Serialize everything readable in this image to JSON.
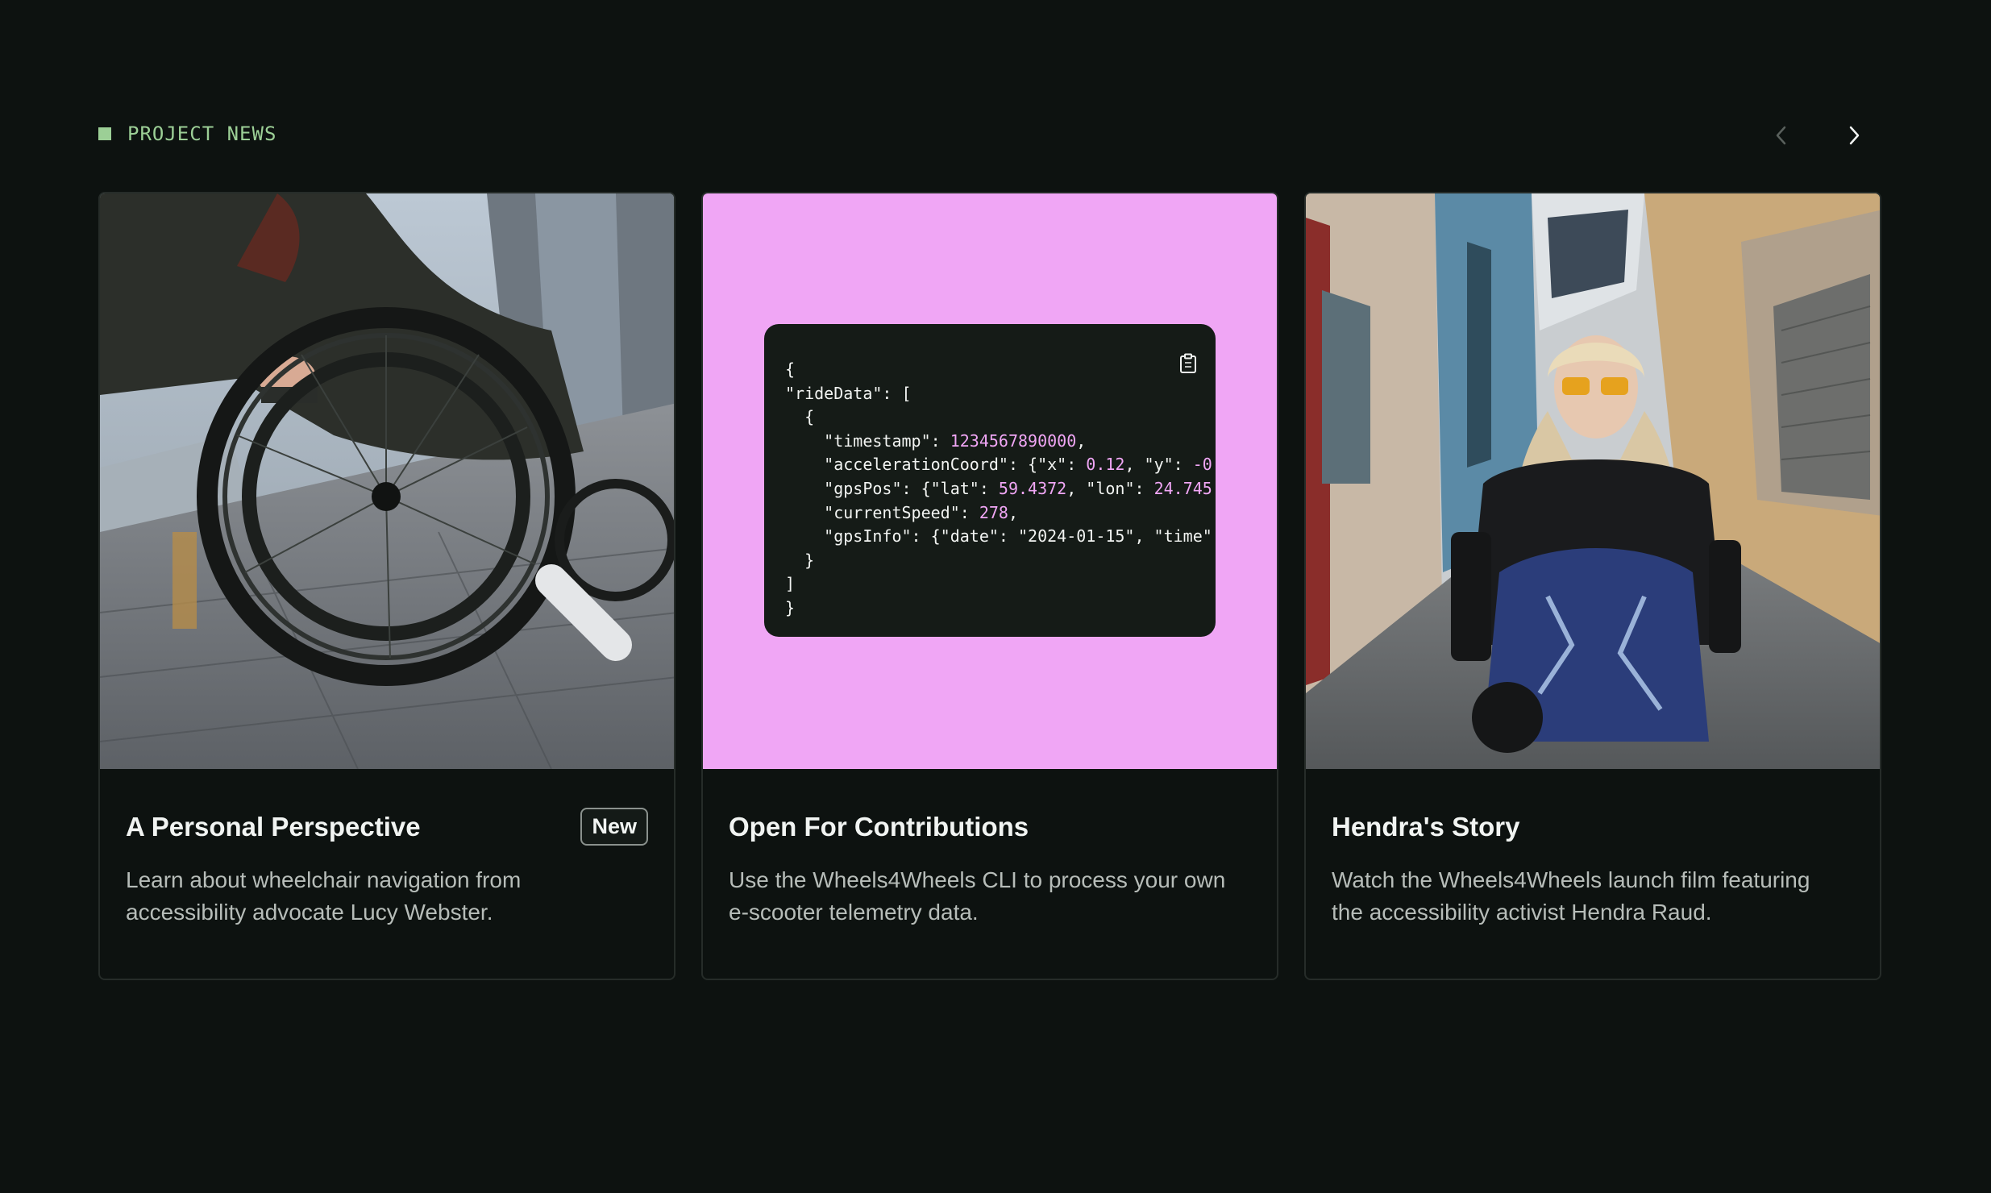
{
  "section": {
    "title": "PROJECT NEWS"
  },
  "nav": {
    "prev_icon": "chevron-left-icon",
    "next_icon": "chevron-right-icon"
  },
  "colors": {
    "background": "#0d1210",
    "accent": "#9ccf96",
    "pink": "#f0a6f5"
  },
  "cards": [
    {
      "title": "A Personal Perspective",
      "badge": "New",
      "description": "Learn about wheelchair navigation from accessibility advocate Lucy Webster."
    },
    {
      "title": "Open For Contributions",
      "description": "Use the Wheels4Wheels CLI to process your own e-scooter telemetry data.",
      "code": {
        "l1": "{",
        "l2": "\"rideData\": [",
        "l3": "  {",
        "l4_key": "    \"timestamp\": ",
        "l4_val": "1234567890000",
        "l4_end": ",",
        "l5_key": "    \"accelerationCoord\": {\"x\": ",
        "l5_val": "0.12",
        "l5_mid": ", \"y\": ",
        "l5_val2": "-0",
        "l6_key": "    \"gpsPos\": {\"lat\": ",
        "l6_val": "59.4372",
        "l6_mid": ", \"lon\": ",
        "l6_val2": "24.745",
        "l7_key": "    \"currentSpeed\": ",
        "l7_val": "278",
        "l7_end": ",",
        "l8": "    \"gpsInfo\": {\"date\": \"2024-01-15\", \"time\"",
        "l9": "  }",
        "l10": "]",
        "l11": "}"
      }
    },
    {
      "title": "Hendra's Story",
      "description": "Watch the Wheels4Wheels launch film featuring the accessibility activist Hendra Raud."
    }
  ]
}
